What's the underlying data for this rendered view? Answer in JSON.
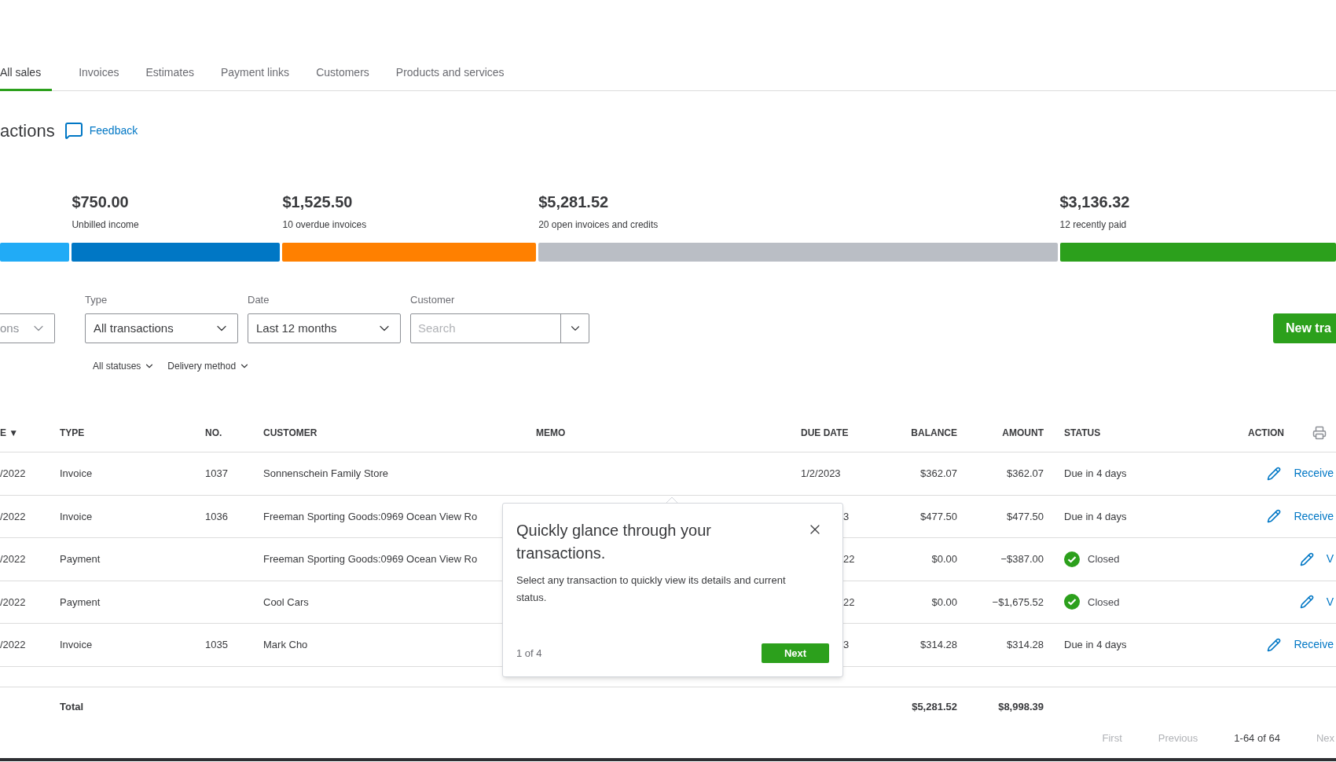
{
  "tabs": [
    {
      "label": "All sales",
      "selected": true
    },
    {
      "label": "Invoices",
      "selected": false
    },
    {
      "label": "Estimates",
      "selected": false
    },
    {
      "label": "Payment links",
      "selected": false
    },
    {
      "label": "Customers",
      "selected": false
    },
    {
      "label": "Products and services",
      "selected": false
    }
  ],
  "page_title": "actions",
  "feedback_link": "Feedback",
  "summary": [
    {
      "color": "#21abf6"
    },
    {
      "amount": "$750.00",
      "label": "Unbilled income",
      "color": "#0077c5"
    },
    {
      "amount": "$1,525.50",
      "label": "10 overdue invoices",
      "color": "#ff8000"
    },
    {
      "amount": "$5,281.52",
      "label": "20 open invoices and credits",
      "color": "#babec5"
    },
    {
      "amount": "$3,136.32",
      "label": "12 recently paid",
      "color": "#2ca01c"
    }
  ],
  "filters": {
    "partial_dropdown": {
      "value": "ons"
    },
    "type": {
      "label": "Type",
      "value": "All transactions"
    },
    "date": {
      "label": "Date",
      "value": "Last 12 months"
    },
    "customer": {
      "label": "Customer",
      "placeholder": "Search"
    },
    "new_button": "New tra",
    "sub_filters": [
      "All statuses",
      "Delivery method"
    ]
  },
  "table": {
    "columns": [
      "E ▼",
      "TYPE",
      "NO.",
      "CUSTOMER",
      "MEMO",
      "DUE DATE",
      "BALANCE",
      "AMOUNT",
      "STATUS",
      "ACTION"
    ],
    "rows": [
      {
        "date": "/2022",
        "type": "Invoice",
        "no": "1037",
        "customer": "Sonnenschein Family Store",
        "due_date": "1/2/2023",
        "balance": "$362.07",
        "amount": "$362.07",
        "status": "Due in 4 days",
        "closed": false,
        "action": "Receive"
      },
      {
        "date": "/2022",
        "type": "Invoice",
        "no": "1036",
        "customer": "Freeman Sporting Goods:0969 Ocean View Ro",
        "due_date": "3",
        "balance": "$477.50",
        "amount": "$477.50",
        "status": "Due in 4 days",
        "closed": false,
        "action": "Receive"
      },
      {
        "date": "/2022",
        "type": "Payment",
        "no": "",
        "customer": "Freeman Sporting Goods:0969 Ocean View Ro",
        "due_date": "22",
        "balance": "$0.00",
        "amount": "−$387.00",
        "status": "Closed",
        "closed": true,
        "action": "V"
      },
      {
        "date": "/2022",
        "type": "Payment",
        "no": "",
        "customer": "Cool Cars",
        "due_date": "22",
        "balance": "$0.00",
        "amount": "−$1,675.52",
        "status": "Closed",
        "closed": true,
        "action": "V"
      },
      {
        "date": "/2022",
        "type": "Invoice",
        "no": "1035",
        "customer": "Mark Cho",
        "due_date": "3",
        "balance": "$314.28",
        "amount": "$314.28",
        "status": "Due in 4 days",
        "closed": false,
        "action": "Receive"
      }
    ],
    "total": {
      "label": "Total",
      "balance": "$5,281.52",
      "amount": "$8,998.39"
    }
  },
  "pagination": [
    {
      "label": "First",
      "kind": "link",
      "disabled": true
    },
    {
      "label": "Previous",
      "kind": "link",
      "disabled": true
    },
    {
      "label": "1-64 of 64",
      "kind": "range"
    },
    {
      "label": "Nex",
      "kind": "link",
      "disabled": true
    }
  ],
  "tooltip": {
    "title": "Quickly glance through your transactions.",
    "body": "Select any transaction to quickly view its details and current status.",
    "step": "1 of 4",
    "button": "Next"
  }
}
